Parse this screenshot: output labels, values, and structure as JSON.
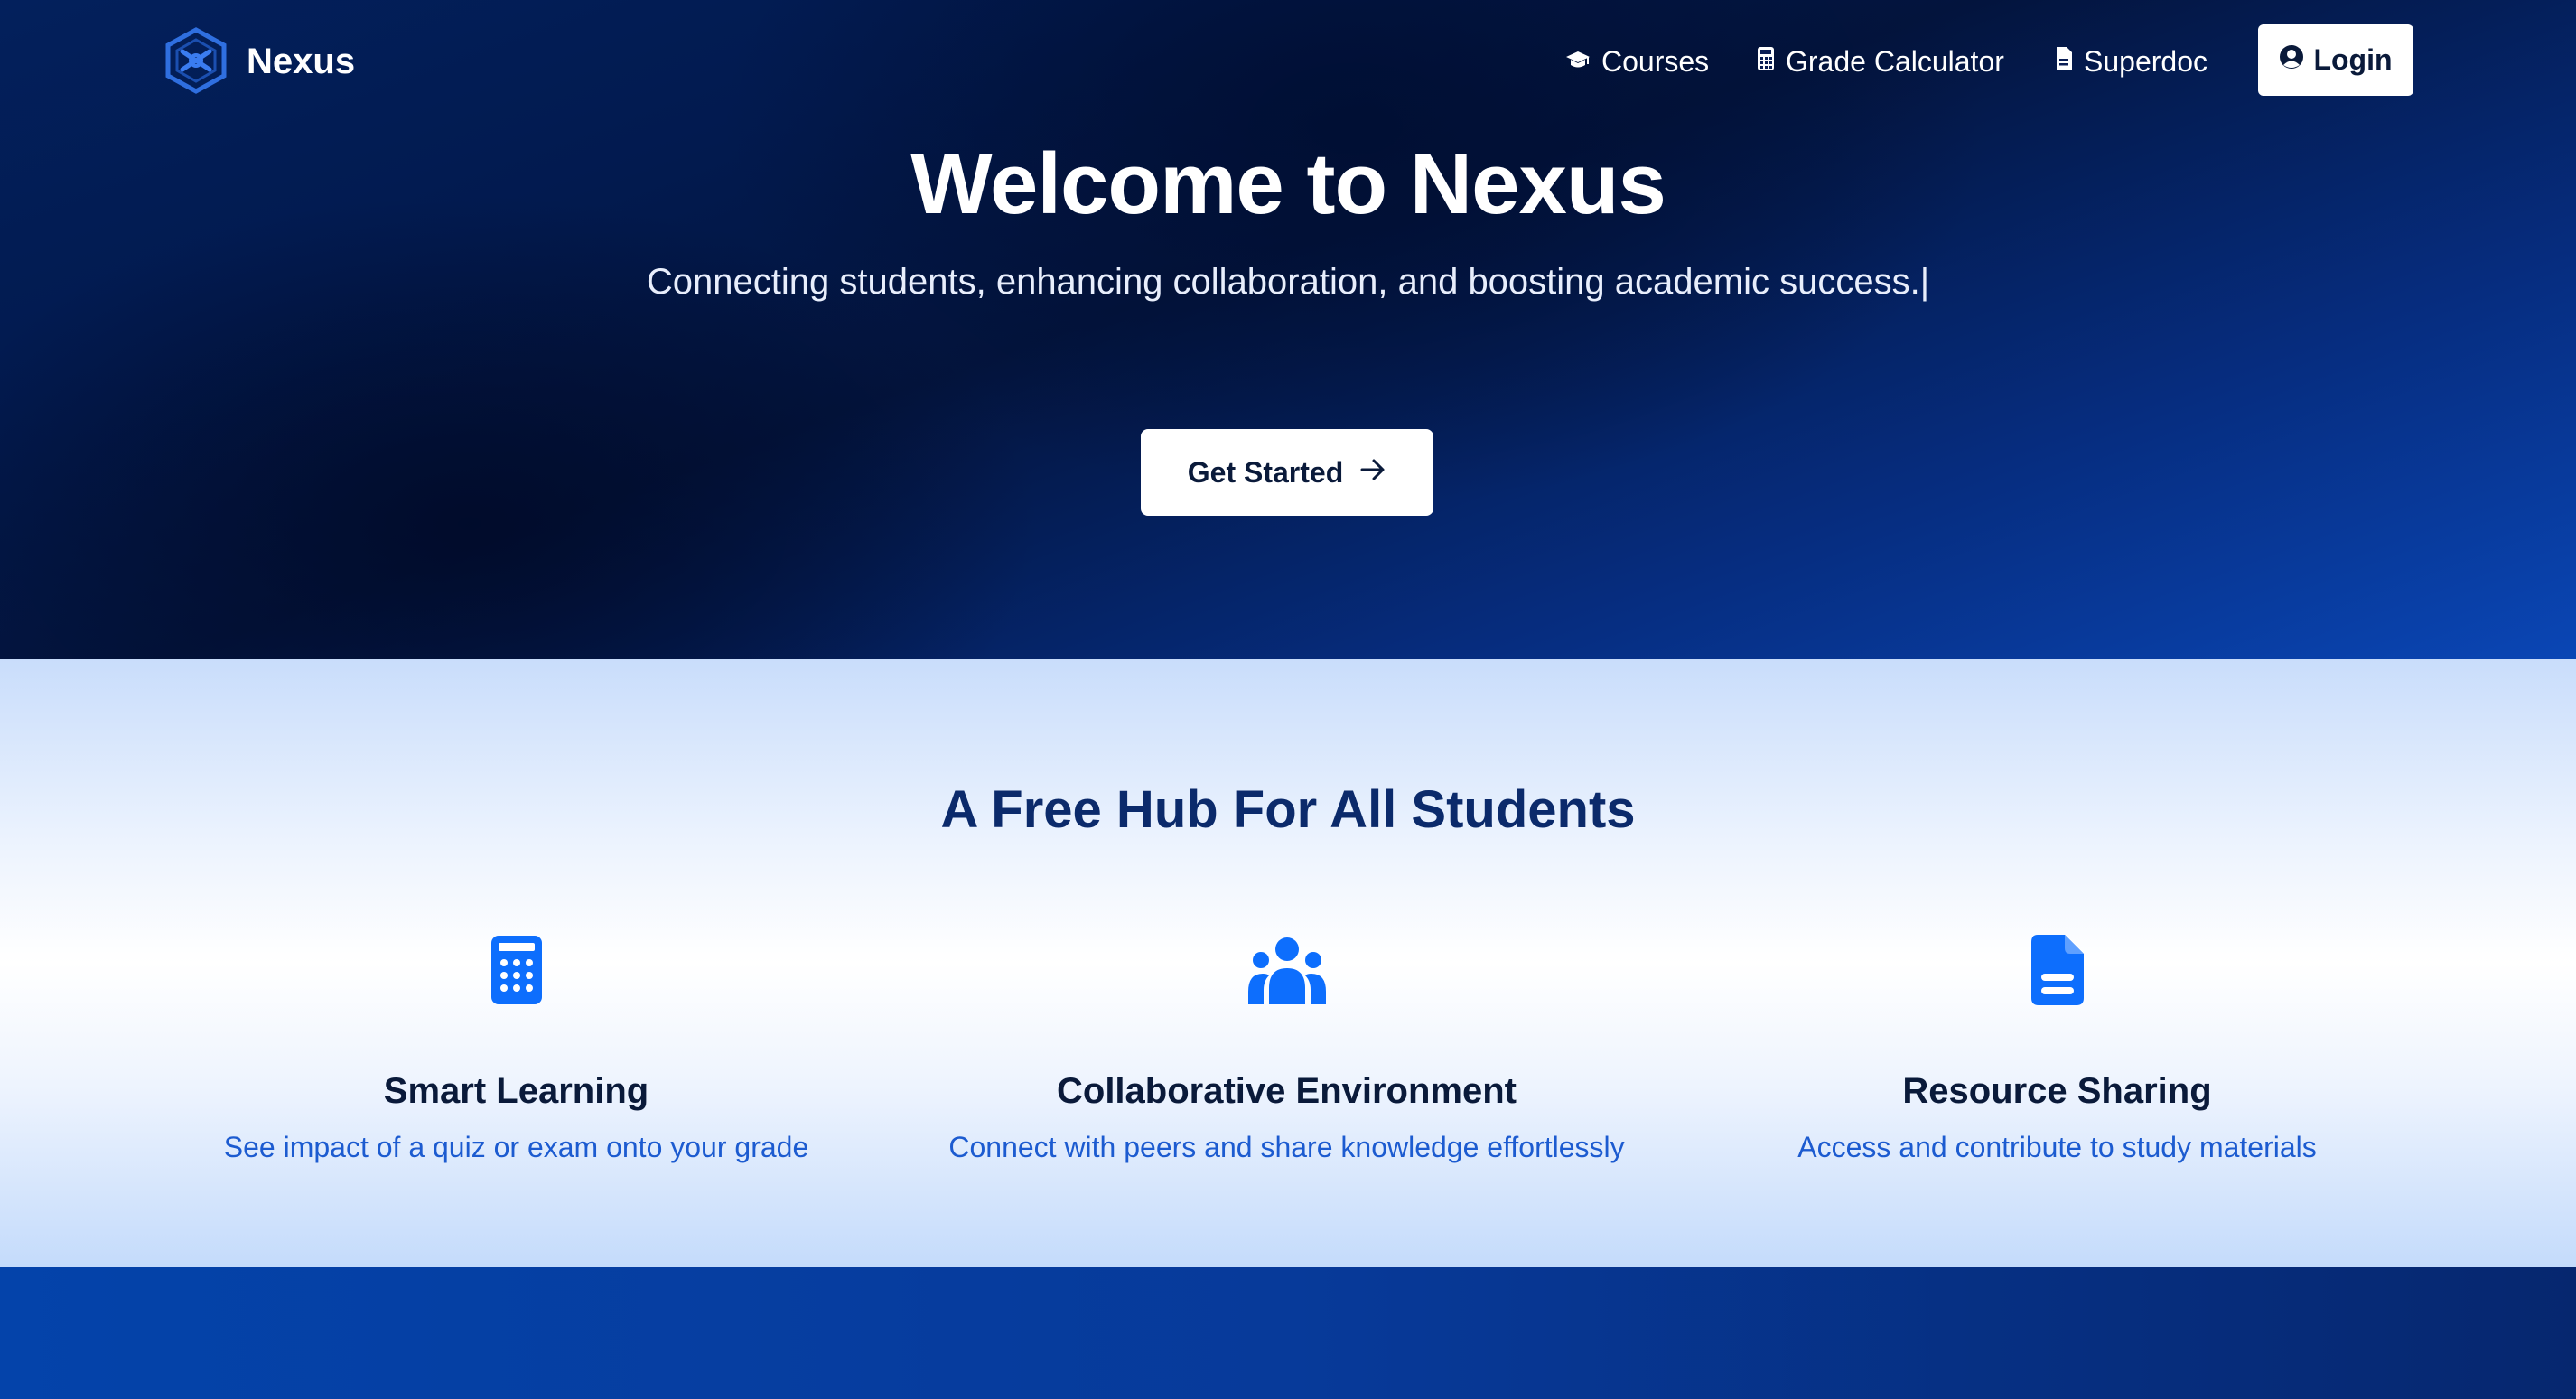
{
  "nav": {
    "brand": "Nexus",
    "links": [
      {
        "label": "Courses",
        "icon": "graduation-cap-icon"
      },
      {
        "label": "Grade Calculator",
        "icon": "calculator-icon"
      },
      {
        "label": "Superdoc",
        "icon": "document-icon"
      }
    ],
    "login_label": "Login"
  },
  "hero": {
    "title": "Welcome to Nexus",
    "subtitle": "Connecting students, enhancing collaboration, and boosting academic success.|",
    "cta_label": "Get Started"
  },
  "features": {
    "title": "A Free Hub For All Students",
    "items": [
      {
        "title": "Smart Learning",
        "description": "See impact of a quiz or exam onto your grade",
        "icon": "calculator-icon"
      },
      {
        "title": "Collaborative Environment",
        "description": "Connect with peers and share knowledge effortlessly",
        "icon": "users-icon"
      },
      {
        "title": "Resource Sharing",
        "description": "Access and contribute to study materials",
        "icon": "document-icon"
      }
    ]
  },
  "colors": {
    "accent": "#0d6efd",
    "heading": "#0b2a6b",
    "description": "#1c5bd0",
    "hero_bg": "#03143d"
  }
}
